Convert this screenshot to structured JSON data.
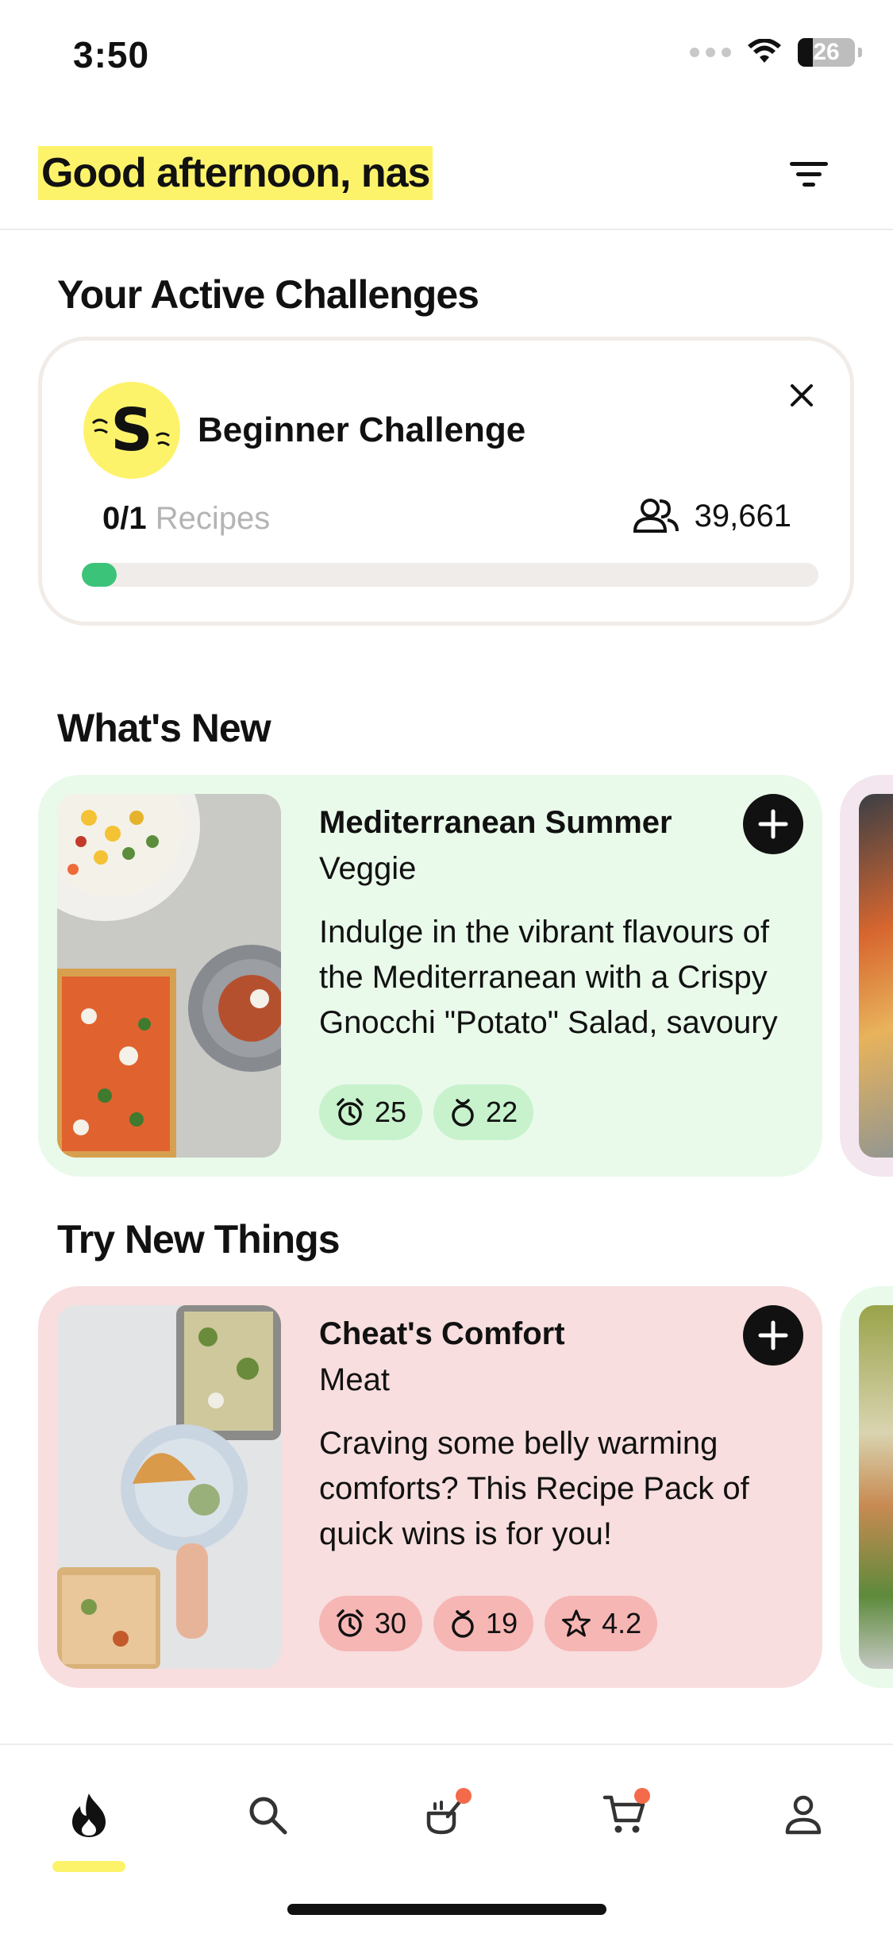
{
  "status_bar": {
    "time": "3:50",
    "battery_level": "26",
    "battery_fraction": 0.26
  },
  "header": {
    "greeting": "Good afternoon, nas",
    "filter_icon": "filter-icon"
  },
  "active_challenges": {
    "section_title": "Your Active Challenges",
    "challenge": {
      "name": "Beginner Challenge",
      "completed_count": "0/1",
      "unit": "Recipes",
      "participants": "39,661",
      "progress_fraction": 0.0
    }
  },
  "whats_new": {
    "section_title": "What's New",
    "card": {
      "title": "Mediterranean Summer",
      "category": "Veggie",
      "description": "Indulge in the vibrant flavours of the Mediterranean with a Crispy Gnocchi \"Potato\" Salad, savoury Ri...",
      "time": "25",
      "recipes": "22",
      "accent_color": "#e9faea"
    }
  },
  "try_new_things": {
    "section_title": "Try New Things",
    "card": {
      "title": "Cheat's Comfort",
      "category": "Meat",
      "description": "Craving some belly warming comforts? This Recipe Pack of quick wins is for you!",
      "time": "30",
      "recipes": "19",
      "rating": "4.2",
      "accent_color": "#f8dede"
    }
  },
  "bottom_nav": {
    "items": [
      "home-flame-icon",
      "search-icon",
      "cooking-pot-icon",
      "cart-icon",
      "profile-icon"
    ],
    "active": "home-flame-icon",
    "indicator_color": "#fdf36b"
  }
}
